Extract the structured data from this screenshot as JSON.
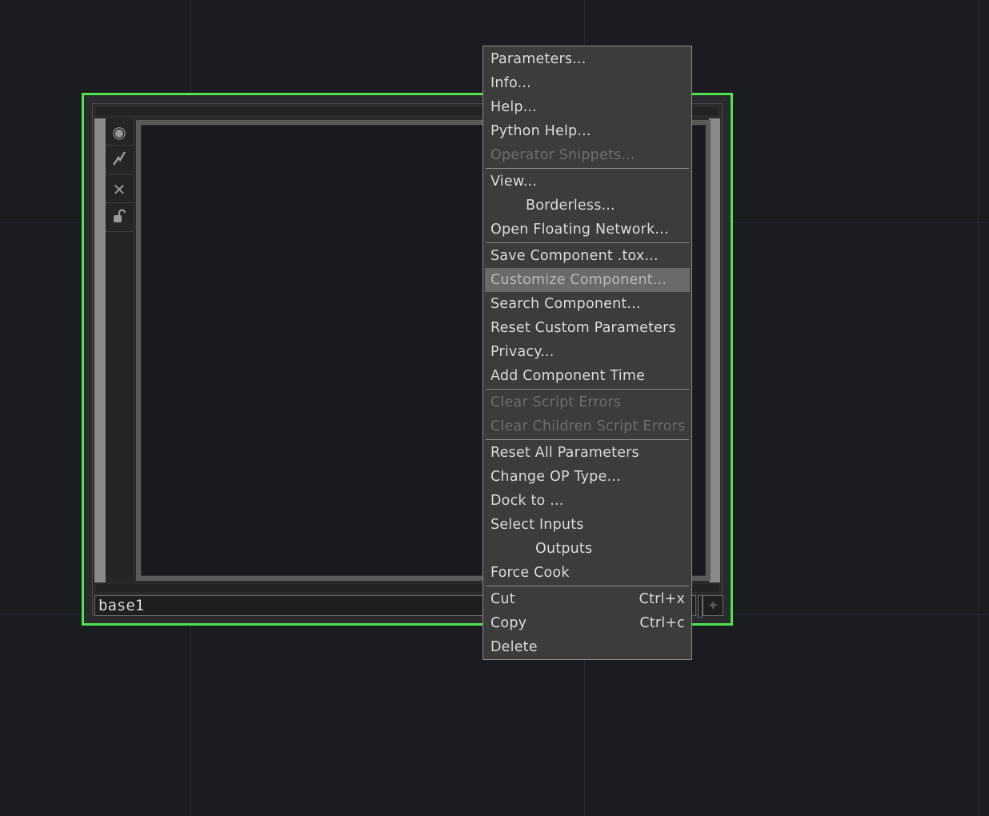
{
  "node": {
    "name": "base1",
    "tools": [
      {
        "icon": "viewer-icon",
        "glyph": "◉"
      },
      {
        "icon": "bypass-icon",
        "glyph": "⚡"
      },
      {
        "icon": "close-icon",
        "glyph": "✕"
      },
      {
        "icon": "lock-icon",
        "glyph": "🔓"
      }
    ],
    "pin_glyph": "✦",
    "accent_color": "#4fe34f"
  },
  "menu": {
    "parameters": "Parameters...",
    "info": "Info...",
    "help": "Help...",
    "python_help": "Python Help...",
    "operator_snippets": "Operator Snippets...",
    "view": "View...",
    "borderless": "Borderless...",
    "open_floating_network": "Open Floating Network...",
    "save_component": "Save Component .tox...",
    "customize_component": "Customize Component...",
    "search_component": "Search Component...",
    "reset_custom_parameters": "Reset Custom Parameters",
    "privacy": "Privacy...",
    "add_component_time": "Add Component Time",
    "clear_script_errors": "Clear Script Errors",
    "clear_children_script_errors": "Clear Children Script Errors",
    "reset_all_parameters": "Reset All Parameters",
    "change_op_type": "Change OP Type...",
    "dock_to": "Dock to ...",
    "select_inputs": "Select Inputs",
    "outputs": "Outputs",
    "force_cook": "Force Cook",
    "cut": "Cut",
    "cut_shortcut": "Ctrl+x",
    "copy": "Copy",
    "copy_shortcut": "Ctrl+c",
    "delete": "Delete"
  }
}
